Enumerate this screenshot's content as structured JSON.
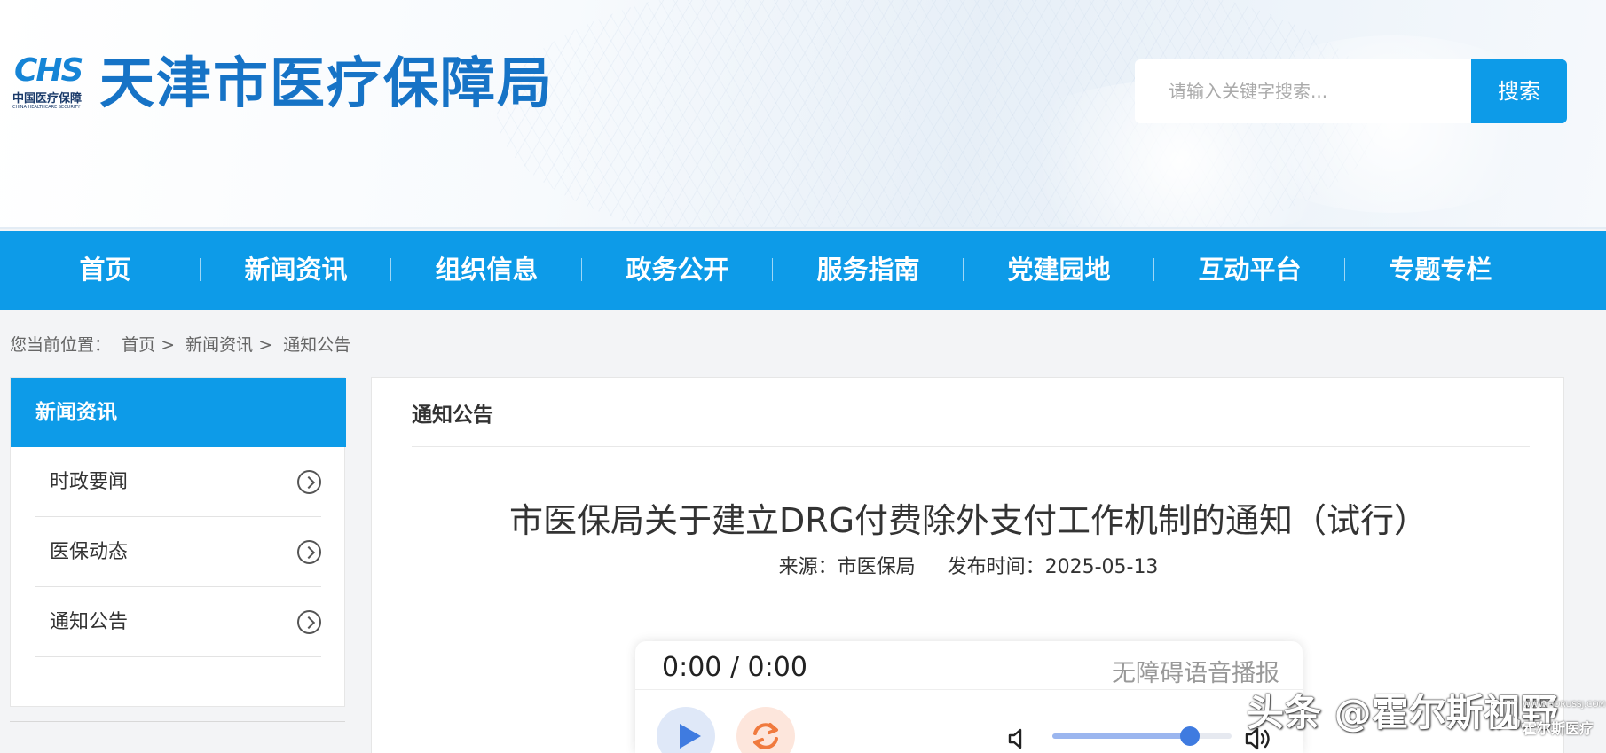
{
  "header": {
    "logo_mark": "CHS",
    "logo_cn": "中国医疗保障",
    "logo_en": "CHINA HEALTHCARE SECURITY",
    "site_title": "天津市医疗保障局",
    "search_placeholder": "请输入关键字搜索...",
    "search_button": "搜索"
  },
  "nav": {
    "items": [
      "首页",
      "新闻资讯",
      "组织信息",
      "政务公开",
      "服务指南",
      "党建园地",
      "互动平台",
      "专题专栏"
    ]
  },
  "breadcrumb": {
    "prefix": "您当前位置：",
    "items": [
      "首页 >",
      "新闻资讯 >",
      "通知公告"
    ]
  },
  "sidebar": {
    "title": "新闻资讯",
    "items": [
      "时政要闻",
      "医保动态",
      "通知公告"
    ]
  },
  "main": {
    "section_title": "通知公告",
    "article_title": "市医保局关于建立DRG付费除外支付工作机制的通知（试行）",
    "source": "来源：市医保局",
    "publish_time": "发布时间：2025-05-13"
  },
  "player": {
    "time": "0:00 / 0:00",
    "label": "无障碍语音播报",
    "volume": 0.75,
    "accent": "#3f7be0"
  },
  "watermark": {
    "text": "头条 @霍尔斯视野",
    "url": "WWW.HORUSSJ.COM",
    "name": "霍尔斯医疗"
  },
  "colors": {
    "primary": "#0d9be8",
    "title_blue": "#1673c6"
  }
}
